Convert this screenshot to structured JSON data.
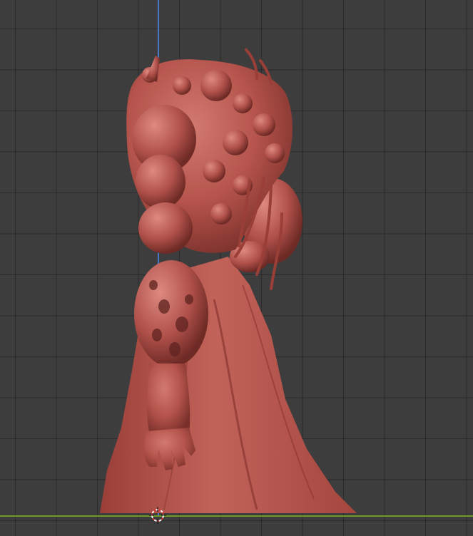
{
  "viewport": {
    "background": "#3d3d3d",
    "grid_color": "#2b2b2b",
    "axis_z_color": "#4a7cd6",
    "axis_y_color": "#6e9a2a"
  },
  "model": {
    "material_color": "#b5544c",
    "shadow_color": "#6e2a25",
    "highlight_color": "#d27a70"
  },
  "cursor": {
    "icon": "3d-cursor-icon"
  }
}
